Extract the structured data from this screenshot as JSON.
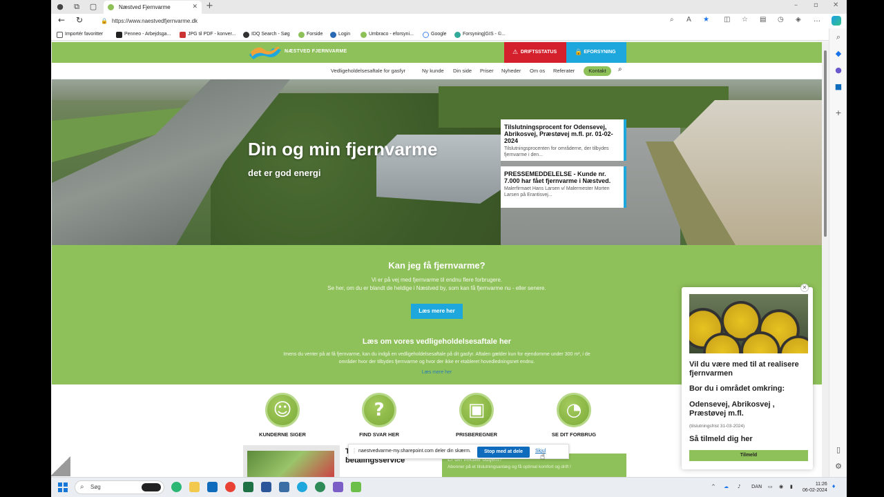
{
  "browser": {
    "tab_title": "Næstved Fjernvarme",
    "url": "https://www.naestvedfjernvarme.dk",
    "favorites": [
      "Importér favoritter",
      "Penneo - Arbejdsga...",
      "JPG til PDF - konver...",
      "IDQ Search - Søg",
      "Forside",
      "Login",
      "Umbraco - eforsyni...",
      "Google",
      "Forsyning|GIS - ©..."
    ]
  },
  "site": {
    "logo_text": "NÆSTVED FJERNVARME",
    "driftsstatus": "DRIFTSSTATUS",
    "eforsyning": "EFORSYNING",
    "menu": [
      "Vedligeholdelsesaftale for gasfyr",
      "Ny kunde",
      "Din side",
      "Priser",
      "Nyheder",
      "Om os",
      "Referater"
    ],
    "kontakt": "Kontakt",
    "hero_title": "Din og min fjernvarme",
    "hero_sub": "det er god energi",
    "news": [
      {
        "title": "Tilslutningsprocent for Odensevej, Abrikosvej, Præstøvej m.fl. pr. 01-02-2024",
        "desc": "Tilslutningsprocenten for områderne, der tilbydes fjernvarme i den..."
      },
      {
        "title": "PRESSEMEDDELELSE - Kunde nr. 7.000 har fået fjernvarme i Næstved.",
        "desc": "Malerfirmaet Hans Larsen v/ Malermester Morten Larsen på Erantisvej..."
      }
    ],
    "green": {
      "title": "Kan jeg få fjernvarme?",
      "line1": "Vi er på vej med fjernvarme til endnu flere forbrugere.",
      "line2": "Se her, om du er blandt de heldige i Næstved by, som kan få fjernvarme nu - eller senere.",
      "button": "Læs mere her",
      "title2": "Læs om vores vedligeholdelsesaftale her",
      "para1": "Imens du venter på at få fjernvarme, kan du indgå en vedligeholdelsesaftale på dit gasfyr. Aftalen gælder kun for ejendomme under 300 m², i de",
      "para2": "områder hvor der tilbydes fjernvarme og hvor der ikke er etableret hovedledningsnet endnu.",
      "link": "Læs mere her"
    },
    "icons": [
      {
        "glyph": "☺",
        "label": "KUNDERNE SIGER"
      },
      {
        "glyph": "?",
        "label": "FIND SVAR HER"
      },
      {
        "glyph": "▣",
        "label": "PRISBEREGNER"
      },
      {
        "glyph": "◔",
        "label": "SE DIT FORBRUG"
      }
    ],
    "bottom1": "Tilmelding til betalingsservice",
    "bottom2_title": "Er din veksler udtjent?",
    "bottom2_text": "Abonner på et tilslutningsanlæg og få optimal komfort og drift !"
  },
  "popup": {
    "h1": "Vil du være med til at realisere fjernvarmen",
    "h2": "Bor du i området omkring:",
    "h3": "Odensevej, Abrikosvej , Præstøvej m.fl.",
    "small": "(tilslutningsfrist 31-03-2024)",
    "h4": "Så tilmeld dig her",
    "button": "Tilmeld"
  },
  "share": {
    "text": "naestvedvarme-my.sharepoint.com deler din skærm.",
    "stop": "Stop med at dele",
    "hide": "Skjul"
  },
  "taskbar": {
    "search": "Søg",
    "lang": "DAN",
    "time": "11:26",
    "date": "06-02-2024"
  }
}
